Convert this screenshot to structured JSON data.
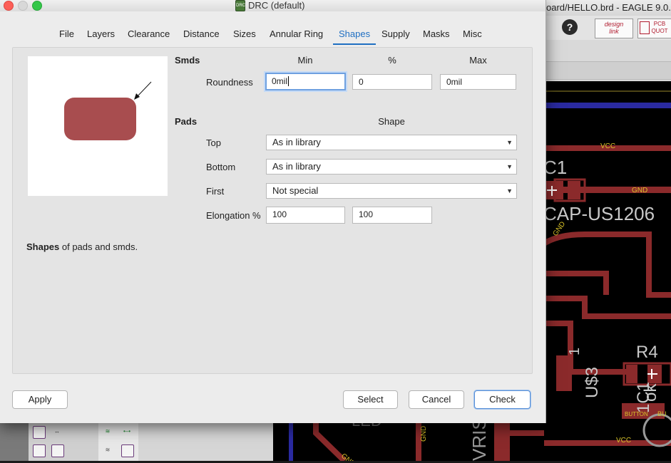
{
  "background_window": {
    "title": "oard/HELLO.brd - EAGLE 9.0.",
    "help_glyph": "?",
    "logo_1": [
      "design",
      "link"
    ],
    "logo_2": [
      "PCB",
      "QUOT"
    ],
    "board_labels": {
      "vcc_top": "VCC",
      "c1": "C1",
      "gnd_1": "GND",
      "cap": "CAP-US1206",
      "gnd_2": "GND",
      "r4": "R4",
      "one": "1",
      "u3": "U$3",
      "ok": "ok",
      "button": "BUTTON",
      "vcc_bottom": "VCC",
      "led": "LED",
      "gnd_3": "GND",
      "gnd_4": "GND",
      "vris": "VRIS",
      "ic1": "1C1",
      "bu": "BU"
    }
  },
  "dialog": {
    "title": "DRC (default)",
    "title_icon": "drc-icon",
    "tabs": [
      {
        "label": "File"
      },
      {
        "label": "Layers"
      },
      {
        "label": "Clearance"
      },
      {
        "label": "Distance"
      },
      {
        "label": "Sizes"
      },
      {
        "label": "Annular Ring"
      },
      {
        "label": "Shapes",
        "active": true
      },
      {
        "label": "Supply"
      },
      {
        "label": "Masks"
      },
      {
        "label": "Misc"
      }
    ],
    "smds": {
      "heading": "Smds",
      "col_min": "Min",
      "col_percent": "%",
      "col_max": "Max",
      "roundness_label": "Roundness",
      "roundness_min": "0mil",
      "roundness_percent": "0",
      "roundness_max": "0mil"
    },
    "pads": {
      "heading": "Pads",
      "col_shape": "Shape",
      "top_label": "Top",
      "top_value": "As in library",
      "bottom_label": "Bottom",
      "bottom_value": "As in library",
      "first_label": "First",
      "first_value": "Not special",
      "elongation_label": "Elongation %",
      "elongation_1": "100",
      "elongation_2": "100"
    },
    "description_bold": "Shapes",
    "description_rest": " of pads and smds.",
    "buttons": {
      "apply": "Apply",
      "select": "Select",
      "cancel": "Cancel",
      "check": "Check"
    },
    "colors": {
      "accent": "#1f6fc2",
      "pad_fill": "#a84d4f",
      "trace": "#8b2a2b"
    }
  }
}
